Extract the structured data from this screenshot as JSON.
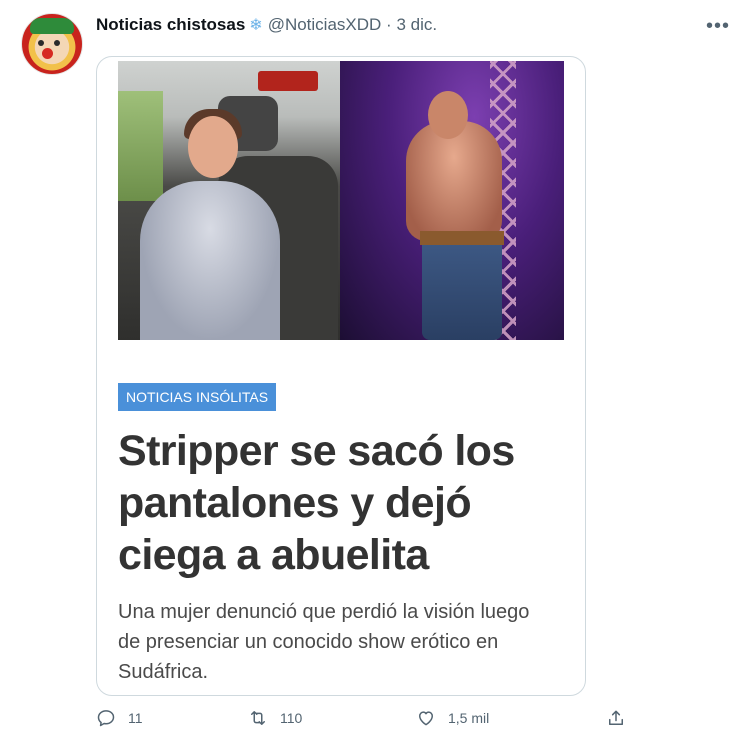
{
  "tweet": {
    "author_name": "Noticias chistosas",
    "author_badge": "❄",
    "handle": "@NoticiasXDD",
    "separator": "·",
    "date": "3 dic.",
    "more": "•••"
  },
  "card": {
    "category": "NOTICIAS INSÓLITAS",
    "headline_lines": [
      "Stripper se sacó los",
      "pantalones y dejó",
      "ciega a abuelita"
    ],
    "summary_lines": [
      "Una mujer denunció que perdió la visión luego",
      "de presenciar un conocido show erótico en",
      "Sudáfrica."
    ]
  },
  "actions": {
    "replies": "11",
    "retweets": "110",
    "likes": "1,5 mil"
  },
  "colors": {
    "badge": "#4a90d9",
    "headline": "#333333",
    "muted": "#536471"
  }
}
